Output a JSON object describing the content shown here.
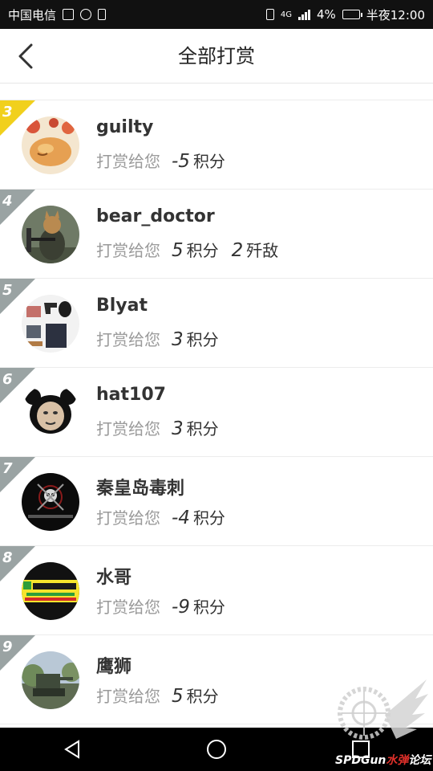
{
  "status_bar": {
    "carrier": "中国电信",
    "network": "4G",
    "battery": "4%",
    "time": "半夜12:00"
  },
  "header": {
    "title": "全部打赏"
  },
  "list": {
    "reward_label": "打赏给您",
    "items": [
      {
        "rank": "3",
        "name": "guilty",
        "rewards": [
          {
            "amount": "-5",
            "unit": "积分"
          }
        ],
        "avatar": "cat-flowers-avatar",
        "ribbon_color": "#f1d01c"
      },
      {
        "rank": "4",
        "name": "bear_doctor",
        "rewards": [
          {
            "amount": "5",
            "unit": "积分"
          },
          {
            "amount": "2",
            "unit": "歼敌"
          }
        ],
        "avatar": "armed-cat-avatar",
        "ribbon_color": "#9aa3a3"
      },
      {
        "rank": "5",
        "name": "Blyat",
        "rewards": [
          {
            "amount": "3",
            "unit": "积分"
          }
        ],
        "avatar": "gear-items-avatar",
        "ribbon_color": "#9aa3a3"
      },
      {
        "rank": "6",
        "name": "hat107",
        "rewards": [
          {
            "amount": "3",
            "unit": "积分"
          }
        ],
        "avatar": "panda-meme-avatar",
        "ribbon_color": "#9aa3a3"
      },
      {
        "rank": "7",
        "name": "秦皇岛毒刺",
        "rewards": [
          {
            "amount": "-4",
            "unit": "积分"
          }
        ],
        "avatar": "skull-emblem-avatar",
        "ribbon_color": "#9aa3a3"
      },
      {
        "rank": "8",
        "name": "水哥",
        "rewards": [
          {
            "amount": "-9",
            "unit": "积分"
          }
        ],
        "avatar": "happy-banner-avatar",
        "ribbon_color": "#9aa3a3"
      },
      {
        "rank": "9",
        "name": "鹰狮",
        "rewards": [
          {
            "amount": "5",
            "unit": "积分"
          }
        ],
        "avatar": "tank-avatar",
        "ribbon_color": "#9aa3a3"
      }
    ]
  },
  "watermark": {
    "text_white": "SPDGun",
    "text_red": "水弹",
    "text_white_2": "论坛"
  }
}
